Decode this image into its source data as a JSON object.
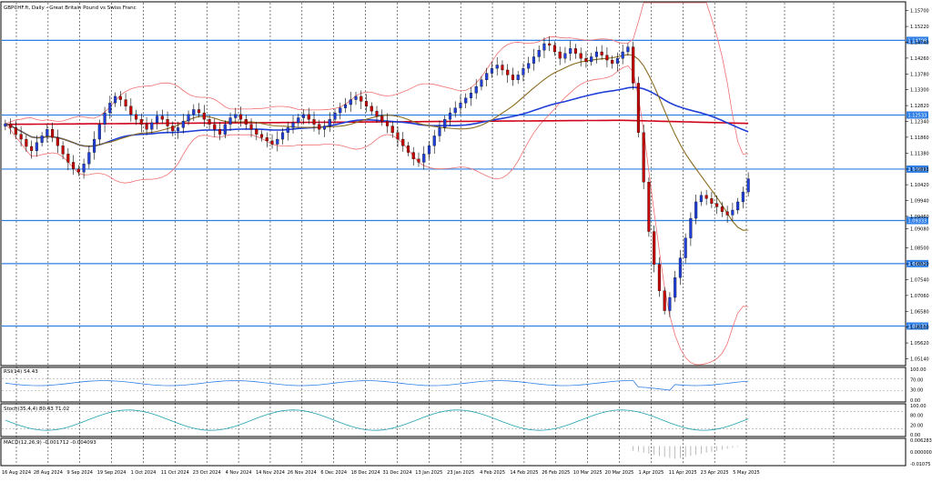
{
  "chart_data": {
    "type": "candlestick",
    "title": "GBPCHF.ft, Daily - Great Britain Pound vs Swiss Franc",
    "price_axis": {
      "ticks": [
        "1.15700",
        "1.15220",
        "1.14740",
        "1.14260",
        "1.13780",
        "1.13300",
        "1.12820",
        "1.12340",
        "1.11860",
        "1.11380",
        "1.10893",
        "1.10420",
        "1.09940",
        "1.09460",
        "1.09080",
        "1.08500",
        "1.08020",
        "1.07540",
        "1.07060",
        "1.06580",
        "1.06100",
        "1.05620",
        "1.05140"
      ],
      "ylim": [
        1.0496,
        1.1594
      ],
      "horizontal_levels": [
        {
          "label": "1.14798",
          "value": 1.14798
        },
        {
          "label": "1.12533",
          "value": 1.12533
        },
        {
          "label": "1.10893",
          "value": 1.10893
        },
        {
          "label": "1.09333",
          "value": 1.09333
        },
        {
          "label": "1.08026",
          "value": 1.08026
        },
        {
          "label": "1.06133",
          "value": 1.06133
        }
      ]
    },
    "x_axis_labels": [
      "16 Aug 2024",
      "28 Aug 2024",
      "9 Sep 2024",
      "19 Sep 2024",
      "1 Oct 2024",
      "11 Oct 2024",
      "23 Oct 2024",
      "4 Nov 2024",
      "14 Nov 2024",
      "26 Nov 2024",
      "6 Dec 2024",
      "18 Dec 2024",
      "31 Dec 2024",
      "13 Jan 2025",
      "23 Jan 2025",
      "4 Feb 2025",
      "14 Feb 2025",
      "26 Feb 2025",
      "10 Mar 2025",
      "20 Mar 2025",
      "1 Apr 2025",
      "11 Apr 2025",
      "23 Apr 2025",
      "5 May 2025"
    ],
    "closes": [
      1.1227,
      1.1215,
      1.1195,
      1.118,
      1.1158,
      1.1145,
      1.117,
      1.119,
      1.121,
      1.1185,
      1.116,
      1.1135,
      1.111,
      1.109,
      1.108,
      1.1105,
      1.114,
      1.118,
      1.1225,
      1.126,
      1.129,
      1.131,
      1.13,
      1.128,
      1.1255,
      1.124,
      1.1225,
      1.121,
      1.123,
      1.125,
      1.124,
      1.122,
      1.1205,
      1.1215,
      1.1235,
      1.1255,
      1.127,
      1.126,
      1.124,
      1.1225,
      1.121,
      1.1195,
      1.1225,
      1.1245,
      1.1255,
      1.124,
      1.1225,
      1.121,
      1.1195,
      1.1185,
      1.1175,
      1.1165,
      1.118,
      1.12,
      1.1215,
      1.123,
      1.1245,
      1.1255,
      1.124,
      1.1225,
      1.121,
      1.122,
      1.124,
      1.126,
      1.1275,
      1.1285,
      1.13,
      1.131,
      1.1295,
      1.128,
      1.1265,
      1.125,
      1.1235,
      1.122,
      1.12,
      1.118,
      1.116,
      1.114,
      1.112,
      1.111,
      1.1135,
      1.116,
      1.119,
      1.1215,
      1.124,
      1.126,
      1.1275,
      1.129,
      1.1305,
      1.132,
      1.134,
      1.136,
      1.138,
      1.1395,
      1.1405,
      1.139,
      1.1375,
      1.136,
      1.1375,
      1.1395,
      1.141,
      1.143,
      1.145,
      1.147,
      1.1465,
      1.1445,
      1.1425,
      1.144,
      1.1455,
      1.144,
      1.1425,
      1.1415,
      1.143,
      1.1445,
      1.1435,
      1.142,
      1.141,
      1.1425,
      1.1445,
      1.146,
      1.135,
      1.12,
      1.105,
      1.09,
      1.08,
      1.072,
      1.066,
      1.07,
      1.076,
      1.082,
      1.088,
      1.094,
      1.099,
      1.101,
      1.1,
      1.0985,
      1.0975,
      1.096,
      1.095,
      1.0965,
      1.099,
      1.102,
      1.106
    ],
    "series": [
      {
        "name": "MA 200",
        "color": "#d0021b"
      },
      {
        "name": "MA 50",
        "color": "#1f3fd8"
      },
      {
        "name": "MA 20",
        "color": "#8b6b1f"
      },
      {
        "name": "Bollinger Bands",
        "color": "#f07070"
      }
    ],
    "indicators": {
      "rsi": {
        "label": "RSI(14) 54.43",
        "ticks": [
          "100.00",
          "70.00",
          "30.00",
          "0.00"
        ]
      },
      "stoch": {
        "label": "Stoch(35,4,4) 80.43 71.02",
        "ticks": [
          "100.00",
          "80.00",
          "20.00",
          "0.00"
        ]
      },
      "macd": {
        "label": "MACD(12,26,9) -0.001712 -0.004093",
        "ticks": [
          "0.006283",
          "0.000000",
          "-0.01075"
        ]
      }
    }
  }
}
